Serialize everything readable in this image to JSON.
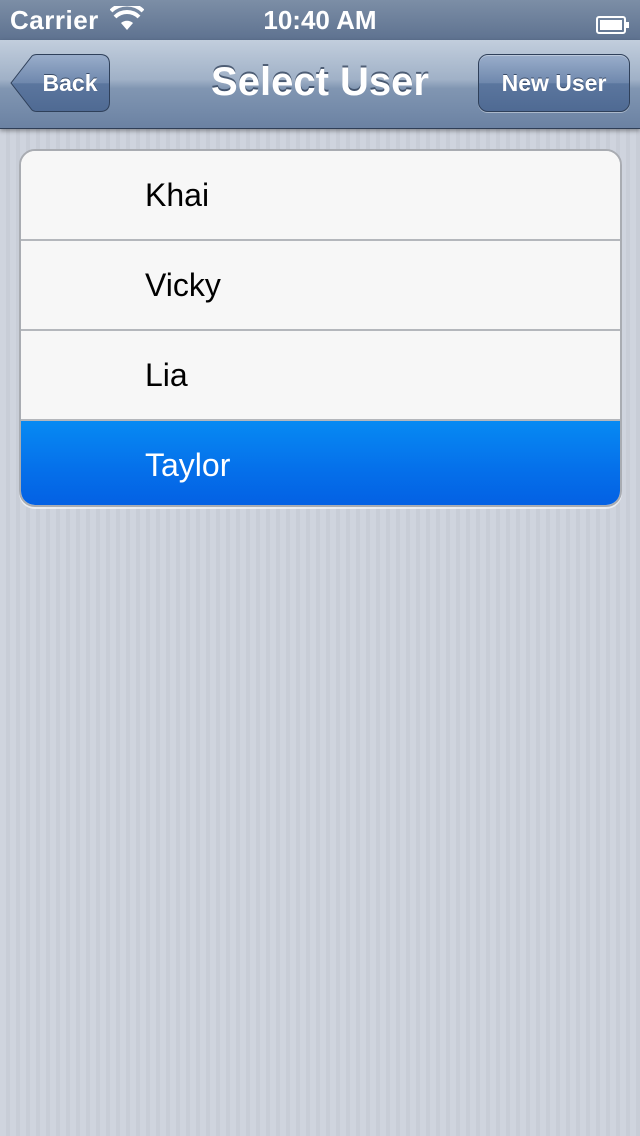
{
  "status_bar": {
    "carrier": "Carrier",
    "time": "10:40 AM",
    "wifi_icon": "wifi-icon",
    "battery_icon": "battery-icon"
  },
  "nav_bar": {
    "title": "Select User",
    "back_label": "Back",
    "new_user_label": "New User"
  },
  "users": [
    {
      "name": "Khai",
      "selected": false
    },
    {
      "name": "Vicky",
      "selected": false
    },
    {
      "name": "Lia",
      "selected": false
    },
    {
      "name": "Taylor",
      "selected": true
    }
  ],
  "colors": {
    "selection": "#0570ea",
    "nav_bar": "#8196b2",
    "background": "#cbd0da"
  }
}
